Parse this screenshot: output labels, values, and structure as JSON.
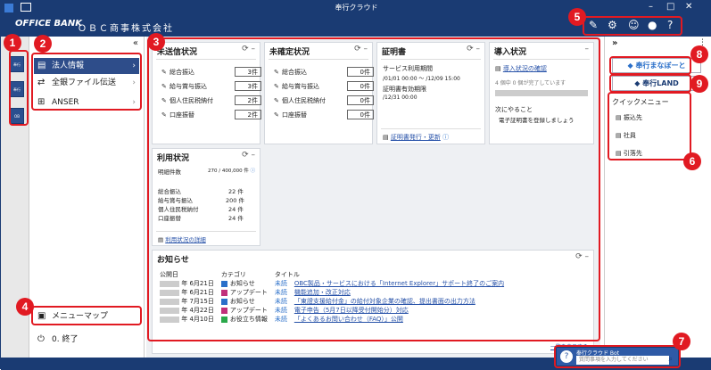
{
  "window": {
    "title": "奉行クラウド"
  },
  "app": {
    "logo": "OFFICE BANK",
    "company": "ＯＢＣ商事株式会社"
  },
  "top_icons": [
    "memo-icon",
    "gear-icon",
    "support-icon",
    "user-icon",
    "help-icon"
  ],
  "left_menu": {
    "items": [
      {
        "label": "法人情報",
        "icon": "building-icon"
      },
      {
        "label": "全銀ファイル伝送",
        "icon": "transfer-icon"
      },
      {
        "label": "ANSER",
        "icon": "network-icon"
      }
    ],
    "menu_map": "メニューマップ",
    "exit": "0. 終了"
  },
  "cards": {
    "unsent": {
      "title": "未送信状況",
      "rows": [
        {
          "label": "総合振込",
          "value": "3件"
        },
        {
          "label": "給与賞与振込",
          "value": "3件"
        },
        {
          "label": "個人住民税納付",
          "value": "2件"
        },
        {
          "label": "口座振替",
          "value": "2件"
        }
      ]
    },
    "unconfirmed": {
      "title": "未確定状況",
      "rows": [
        {
          "label": "総合振込",
          "value": "0件"
        },
        {
          "label": "給与賞与振込",
          "value": "0件"
        },
        {
          "label": "個人住民税納付",
          "value": "0件"
        },
        {
          "label": "口座振替",
          "value": "0件"
        }
      ]
    },
    "cert": {
      "title": "証明書",
      "period_label": "サービス利用期間",
      "period_value": "/01/01 00:00 ～ /12/09 15:00",
      "expiry_label": "証明書有効期限",
      "expiry_value": "/12/31 00:00",
      "link": "証明書発行・更新"
    },
    "intro": {
      "title": "導入状況",
      "link": "導入状況の確認",
      "progress_text": "4 個中 0 個が完了しています",
      "progress": 0,
      "next_label": "次にやること",
      "next_text": "電子証明書を登録しましょう"
    },
    "usage": {
      "title": "利用状況",
      "total_label": "明細件数",
      "total_value": "270 / 400,000 件",
      "rows": [
        {
          "label": "総合振込",
          "value": "22 件"
        },
        {
          "label": "給与賞与振込",
          "value": "200 件"
        },
        {
          "label": "個人住民税納付",
          "value": "24 件"
        },
        {
          "label": "口座振替",
          "value": "24 件"
        }
      ],
      "link": "利用状況の詳細"
    },
    "news": {
      "title": "お知らせ",
      "headers": [
        "公開日",
        "カテゴリ",
        "タイトル"
      ],
      "rows": [
        {
          "date": "年 6月21日",
          "color": "#2a6fc9",
          "category": "お知らせ",
          "status": "未読",
          "title": "OBC製品・サービスにおける「Internet Explorer」サポート終了のご案内"
        },
        {
          "date": "年 6月21日",
          "color": "#c0307a",
          "category": "アップデート",
          "status": "未読",
          "title": "機能追加・改正対応"
        },
        {
          "date": "年 7月15日",
          "color": "#2a6fc9",
          "category": "お知らせ",
          "status": "未読",
          "title": "「東證支援給付金」の給付対象企業の確認、提出書面の出力方法"
        },
        {
          "date": "年 4月22日",
          "color": "#c0307a",
          "category": "アップデート",
          "status": "未読",
          "title": "電子申告（5月7日以降受付開始分）対応"
        },
        {
          "date": "年 4月10日",
          "color": "#2aa84a",
          "category": "お役立ち情報",
          "status": "未読",
          "title": "「よくあるお問い合わせ（FAQ）」公開"
        }
      ],
      "more": "一覧を表示する"
    }
  },
  "right_panel": {
    "banner1": "奉行まなぼーと",
    "banner2": "奉行LAND",
    "quick_title": "クイックメニュー",
    "quick_items": [
      "振込先",
      "社員",
      "引落先"
    ]
  },
  "bot": {
    "title": "奉行クラウド Bot",
    "placeholder": "質問事項を入力してください"
  },
  "annotations": [
    "1",
    "2",
    "3",
    "4",
    "5",
    "6",
    "7",
    "8",
    "9"
  ]
}
